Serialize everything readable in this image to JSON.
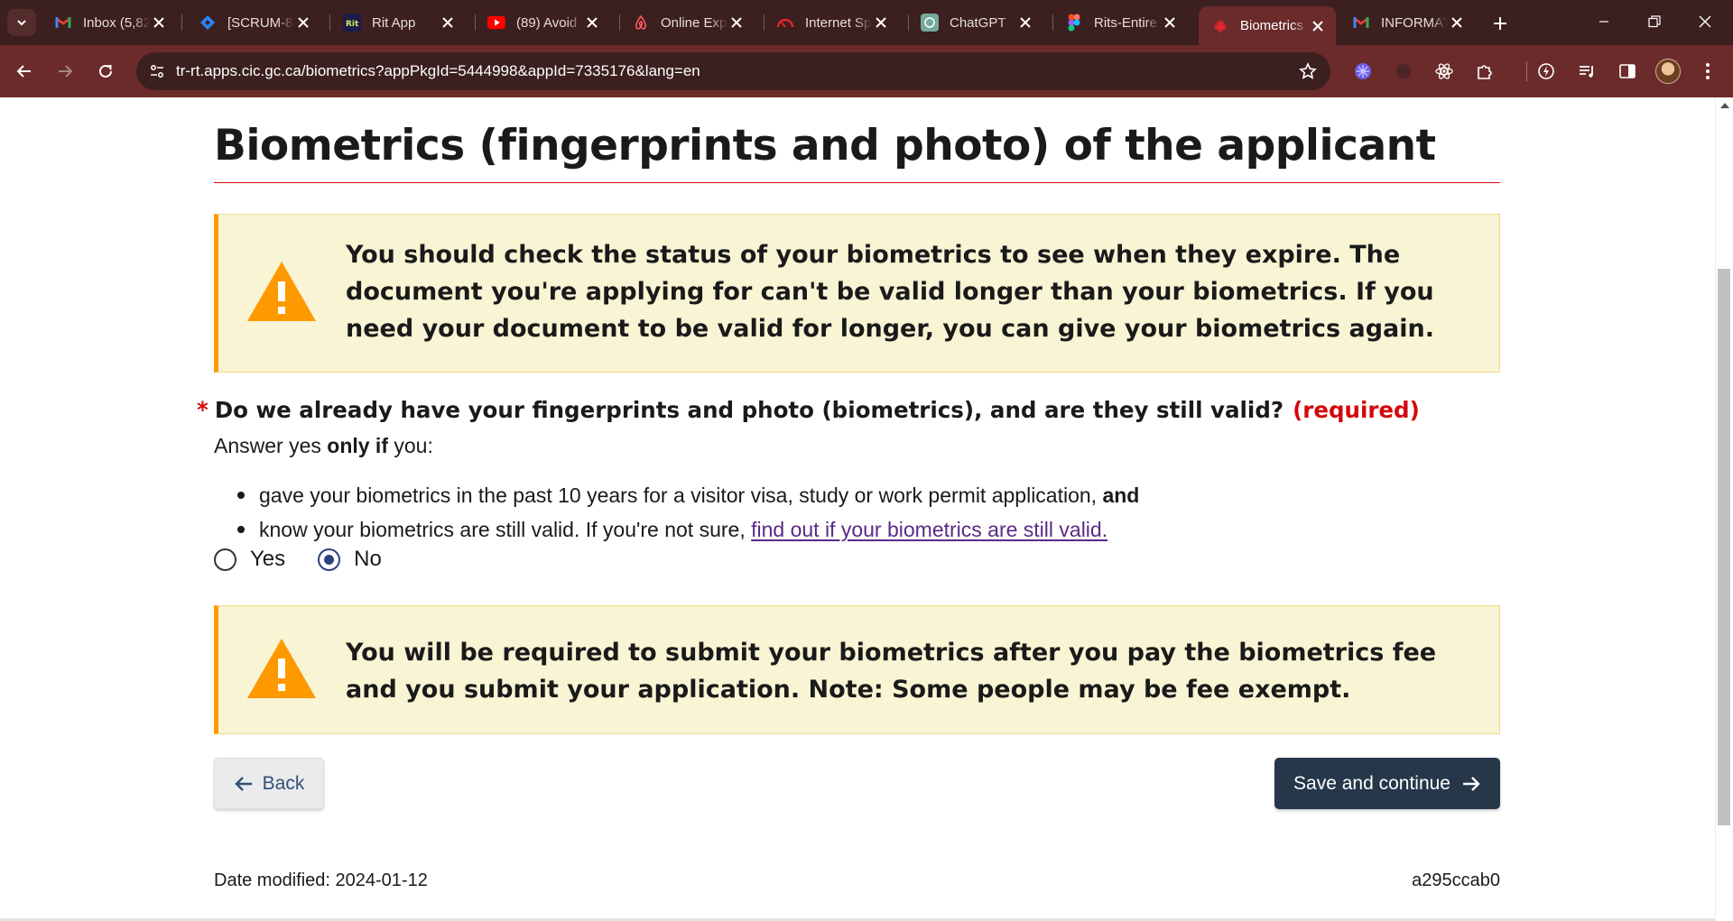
{
  "browser": {
    "tabs": [
      {
        "title": "Inbox (5,82",
        "icon": "gmail-icon",
        "active": false
      },
      {
        "title": "[SCRUM-8",
        "icon": "jira-icon",
        "active": false
      },
      {
        "title": "Rit App",
        "icon": "rit-app-icon",
        "active": false
      },
      {
        "title": "(89) Avoid",
        "icon": "youtube-icon",
        "active": false
      },
      {
        "title": "Online Exp",
        "icon": "airbnb-icon",
        "active": false
      },
      {
        "title": "Internet Sp",
        "icon": "speedtest-icon",
        "active": false
      },
      {
        "title": "ChatGPT",
        "icon": "chatgpt-icon",
        "active": false
      },
      {
        "title": "Rits-Entire",
        "icon": "figma-icon",
        "active": false
      },
      {
        "title": "Biometrics",
        "icon": "maple-leaf-icon",
        "active": true
      },
      {
        "title": "INFORMAT",
        "icon": "gmail-icon",
        "active": false
      }
    ],
    "address_bar": {
      "url": "tr-rt.apps.cic.gc.ca/biometrics?appPkgId=5444998&appId=7335176&lang=en"
    },
    "colors": {
      "frame": "#3c1f1f",
      "toolbar": "#6b2b2b",
      "active_tab": "#6b2b2b"
    }
  },
  "page": {
    "title": "Biometrics (fingerprints and photo) of the applicant",
    "alert_top": {
      "text": "You should check the status of your biometrics to see when they expire. The document you're applying for can't be valid longer than your biometrics. If you need your document to be valid for longer, you can give your biometrics again."
    },
    "question": {
      "star": "*",
      "label": "Do we already have your fingerprints and photo (biometrics), and are they still valid?",
      "required": "(required)",
      "hint_before": "Answer yes ",
      "hint_bold": "only if",
      "hint_after": " you:",
      "bullets": [
        {
          "text": "gave your biometrics in the past 10 years for a visitor visa, study or work permit application, ",
          "bold": "and"
        },
        {
          "text": "know your biometrics are still valid. If you're not sure, ",
          "link": "find out if your biometrics are still valid."
        }
      ],
      "options": [
        {
          "label": "Yes",
          "checked": false
        },
        {
          "label": "No",
          "checked": true
        }
      ]
    },
    "alert_bottom": {
      "text": "You will be required to submit your biometrics after you pay the biometrics fee and you submit your application. Note: Some people may be fee exempt."
    },
    "buttons": {
      "back": "Back",
      "save": "Save and continue"
    },
    "footer": {
      "date_modified": "Date modified: 2024-01-12",
      "build_id": "a295ccab0"
    },
    "colors": {
      "alert_bg": "#f9f4d4",
      "alert_border": "#ff9900",
      "required_red": "#d3080c",
      "primary_button": "#26374a",
      "link": "#5b2a86"
    }
  }
}
